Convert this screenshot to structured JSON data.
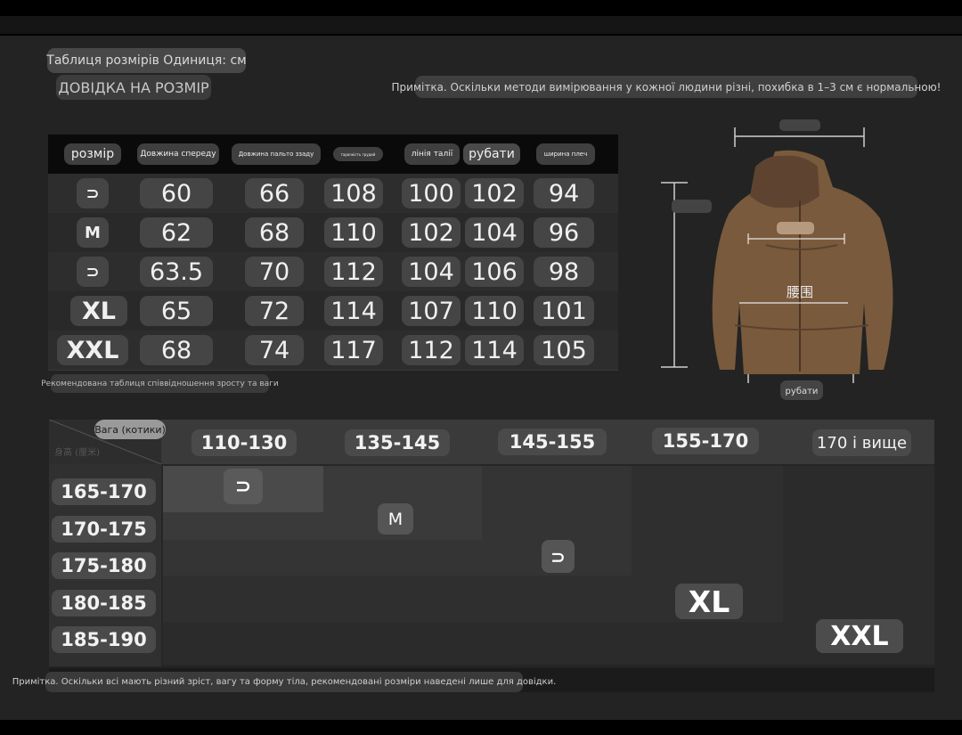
{
  "header": {
    "title": "Таблиця розмірів Одиниця: см",
    "guide": "ДОВІДКА НА РОЗМІР",
    "note": "Примітка. Оскільки методи вимірювання у кожної людини різні, похибка в 1–3 см є нормальною!"
  },
  "size_table": {
    "columns": [
      "розмір",
      "Довжина спереду",
      "Довжина пальто ззаду",
      "тараnкість грудей",
      "лінія талії",
      "рубати",
      "ширина плеч"
    ],
    "rows": [
      [
        "⊃",
        "60",
        "66",
        "108",
        "100",
        "102",
        "94"
      ],
      [
        "M",
        "62",
        "68",
        "110",
        "102",
        "104",
        "96"
      ],
      [
        "⊃",
        "63.5",
        "70",
        "112",
        "104",
        "106",
        "98"
      ],
      [
        "XL",
        "65",
        "72",
        "114",
        "107",
        "110",
        "101"
      ],
      [
        "XXL",
        "68",
        "74",
        "117",
        "112",
        "114",
        "105"
      ]
    ]
  },
  "recommendation_note": "Рекомендована таблиця співвідношення зросту та ваги",
  "jacket": {
    "waist_label": "腰围",
    "bottom_label": "рубати"
  },
  "rec_table": {
    "weight_label": "Вага (котики)",
    "corner_label": "身高 (厘米)",
    "weights": [
      "110-130",
      "135-145",
      "145-155",
      "155-170",
      "170 і вище"
    ],
    "heights": [
      "165-170",
      "170-175",
      "175-180",
      "180-185",
      "185-190"
    ],
    "badges": [
      "⊃",
      "M",
      "⊃",
      "XL",
      "XXL"
    ]
  },
  "footer_note": "Примітка. Оскільки всі мають різний зріст, вагу та форму тіла, рекомендовані розміри наведені лише для довідки."
}
